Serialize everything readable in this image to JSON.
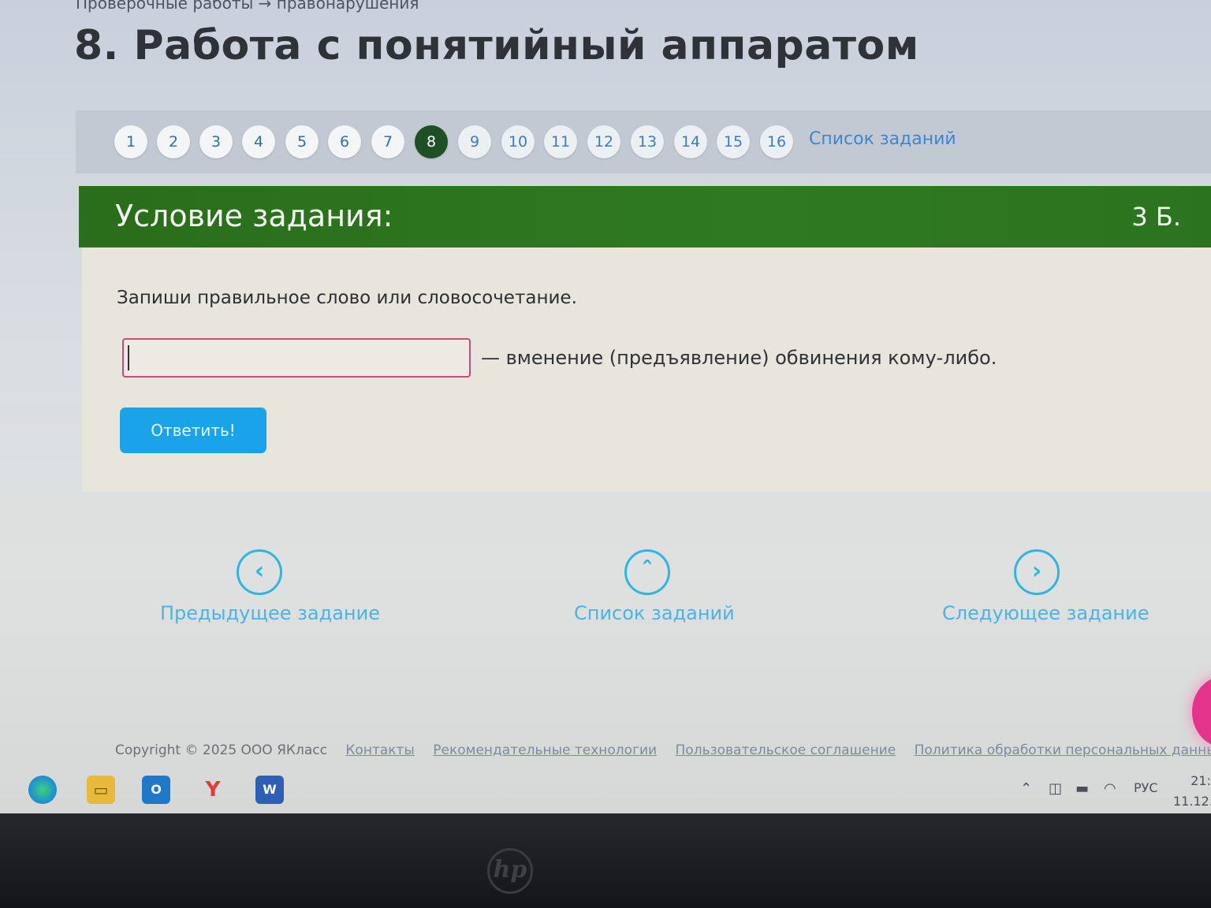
{
  "page": {
    "crumb": "Проверочные работы → правонарушения",
    "title": "8. Работа с понятийный аппаратом"
  },
  "task_nav": {
    "items": [
      "1",
      "2",
      "3",
      "4",
      "5",
      "6",
      "7",
      "8",
      "9",
      "10",
      "11",
      "12",
      "13",
      "14",
      "15",
      "16"
    ],
    "current": "8",
    "list_link": "Список заданий"
  },
  "task": {
    "header": "Условие задания:",
    "points": "3 Б.",
    "instruction": "Запиши правильное слово или словосочетание.",
    "answer_value": "",
    "definition": "— вменение (предъявление) обвинения кому-либо.",
    "submit_label": "Ответить!"
  },
  "bottom_nav": {
    "prev_label": "Предыдущее задание",
    "list_label": "Список заданий",
    "next_label": "Следующее задание"
  },
  "footer": {
    "copyright": "Copyright © 2025 ООО ЯКласс",
    "links": [
      "Контакты",
      "Рекомендательные технологии",
      "Пользовательское соглашение",
      "Политика обработки персональных данных"
    ]
  },
  "taskbar": {
    "icons": [
      "edge-icon",
      "file-explorer-icon",
      "outlook-icon",
      "yandex-browser-icon",
      "word-icon"
    ],
    "tray_language": "РУС",
    "clock_time": "21:",
    "clock_date": "11.12."
  },
  "colors": {
    "accent_green": "#2f7a20",
    "current_task": "#1f4f24",
    "button_blue": "#1ba3ea",
    "link_blue": "#3b87d6"
  }
}
